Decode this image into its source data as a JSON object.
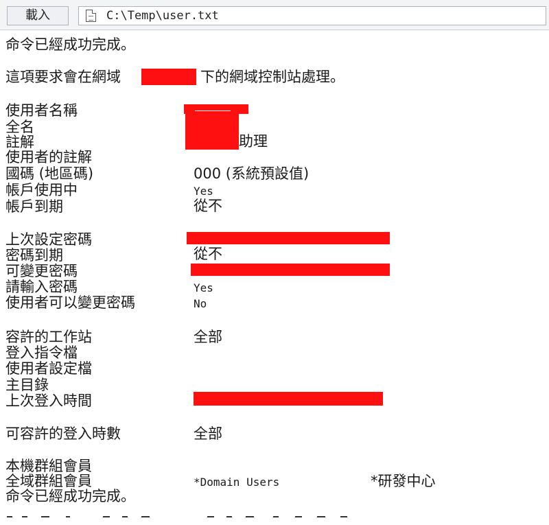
{
  "toolbar": {
    "load_label": "載入",
    "path": "C:\\Temp\\user.txt",
    "file_icon": "document-icon"
  },
  "output": {
    "line_success_1": "命令已經成功完成。",
    "line_request_before": "這項要求會在網域",
    "line_request_after": "下的網域控制站處理。",
    "labels": {
      "user_name": "使用者名稱",
      "full_name": "全名",
      "comment": "註解",
      "user_comment": "使用者的註解",
      "country_code": "國碼 (地區碼)",
      "account_active": "帳戶使用中",
      "account_expires": "帳戶到期",
      "password_last_set": "上次設定密碼",
      "password_expires": "密碼到期",
      "password_changeable": "可變更密碼",
      "password_required": "請輸入密碼",
      "user_may_change_password": "使用者可以變更密碼",
      "workstations_allowed": "容許的工作站",
      "logon_script": "登入指令檔",
      "user_profile": "使用者設定檔",
      "home_directory": "主目錄",
      "last_logon": "上次登入時間",
      "logon_hours_allowed": "可容許的登入時數",
      "local_group_memberships": "本機群組會員",
      "global_group_memberships": "全域群組會員"
    },
    "values": {
      "comment_suffix": "助理",
      "country_code": "000 (系統預設值)",
      "account_active": "Yes",
      "account_expires": "從不",
      "password_expires": "從不",
      "password_required": "Yes",
      "user_may_change_password": "No",
      "workstations_allowed": "全部",
      "logon_hours_allowed": "全部",
      "global_group_1": "*Domain Users",
      "global_group_2": "*研發中心"
    },
    "line_success_2": "命令已經成功完成。"
  },
  "redaction_color": "#ff1010"
}
